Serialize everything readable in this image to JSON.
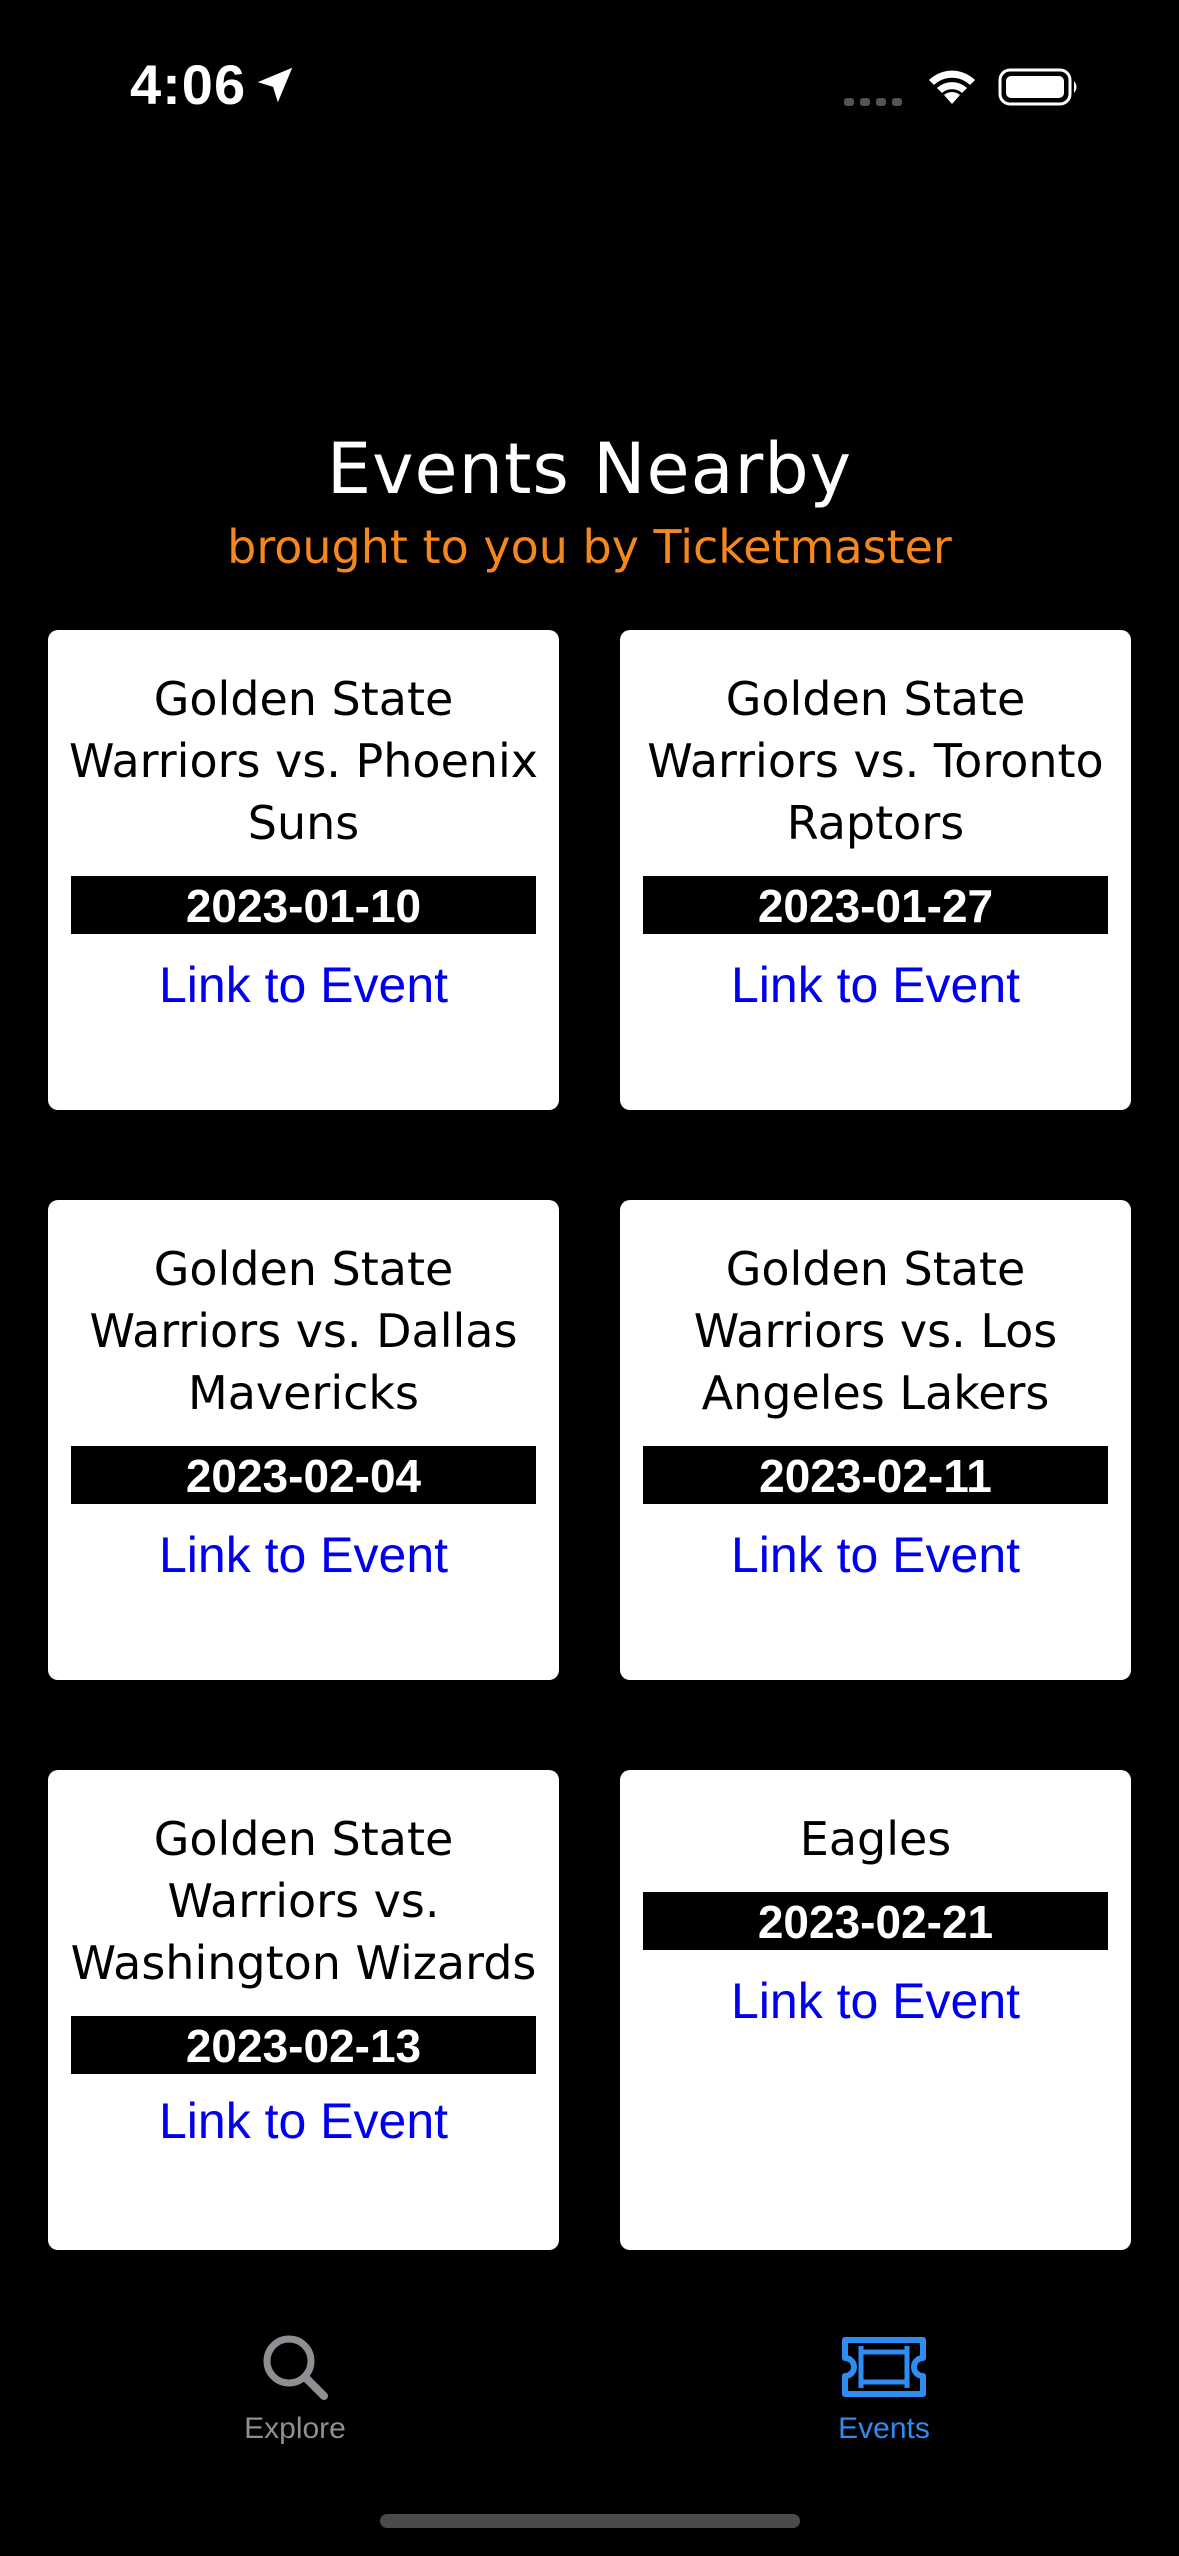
{
  "status_bar": {
    "time": "4:06",
    "icons": [
      "location-arrow-icon",
      "cellular-signal-icon",
      "wifi-icon",
      "battery-icon"
    ]
  },
  "header": {
    "title": "Events Nearby",
    "subtitle": "brought to you by Ticketmaster",
    "subtitle_color": "#f5871f"
  },
  "events": [
    {
      "title": "Golden State Warriors vs. Phoenix Suns",
      "date": "2023-01-10",
      "link_label": "Link to Event"
    },
    {
      "title": "Golden State Warriors vs. Toronto Raptors",
      "date": "2023-01-27",
      "link_label": "Link to Event"
    },
    {
      "title": "Golden State Warriors vs. Dallas Mavericks",
      "date": "2023-02-04",
      "link_label": "Link to Event"
    },
    {
      "title": "Golden State Warriors vs. Los Angeles Lakers",
      "date": "2023-02-11",
      "link_label": "Link to Event"
    },
    {
      "title": "Golden State Warriors vs. Washington Wizards",
      "date": "2023-02-13",
      "link_label": "Link to Event"
    },
    {
      "title": "Eagles",
      "date": "2023-02-21",
      "link_label": "Link to Event"
    }
  ],
  "link_color": "#0000ee",
  "tab_bar": {
    "tabs": [
      {
        "label": "Explore",
        "icon": "magnifying-glass-icon",
        "selected": false
      },
      {
        "label": "Events",
        "icon": "ticket-icon",
        "selected": true
      }
    ],
    "selected_color": "#2f8cf2",
    "unselected_color": "#8e8e93"
  }
}
